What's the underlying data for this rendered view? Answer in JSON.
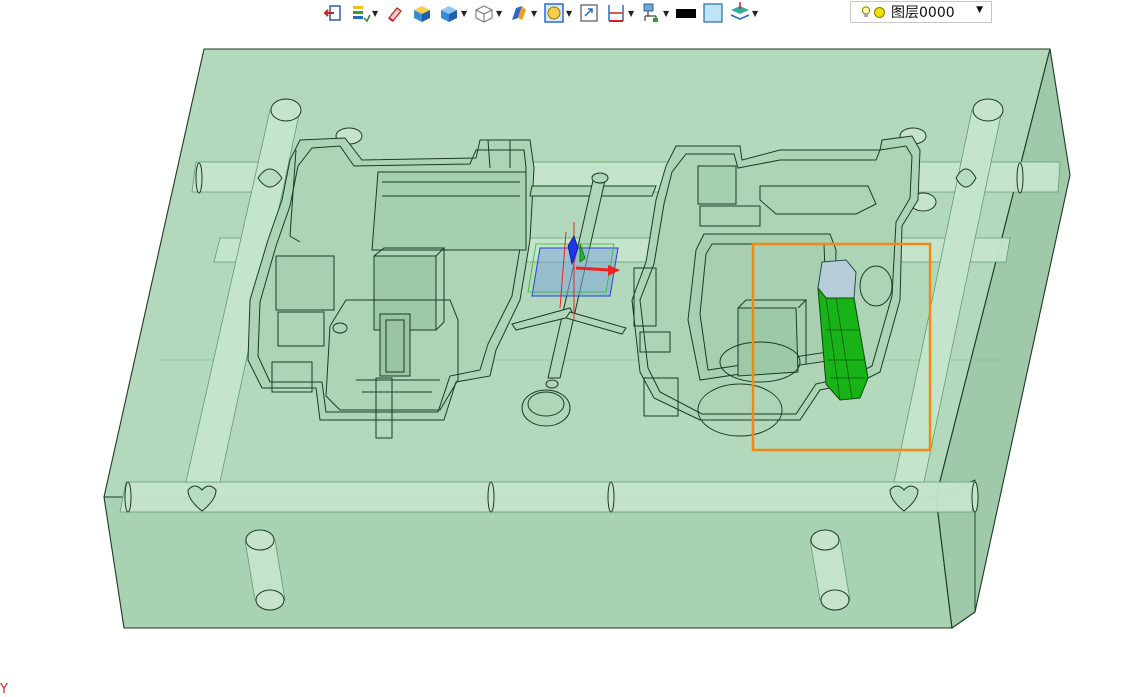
{
  "toolbar": {
    "buttons": [
      {
        "name": "exit-sketch-icon",
        "caret": false
      },
      {
        "name": "layers-list-icon",
        "caret": true
      },
      {
        "name": "eraser-icon",
        "caret": false
      },
      {
        "name": "shaded-view-icon",
        "caret": false
      },
      {
        "name": "solid-box-icon",
        "caret": true
      },
      {
        "name": "wireframe-box-icon",
        "caret": true
      },
      {
        "name": "view-orient-icon",
        "caret": true
      },
      {
        "name": "render-mode-icon",
        "caret": true
      },
      {
        "name": "zoom-fit-icon",
        "caret": false
      },
      {
        "name": "dimension-icon",
        "caret": true
      },
      {
        "name": "filter-icon",
        "caret": true
      },
      {
        "name": "color-swatch-icon",
        "caret": false
      },
      {
        "name": "transparency-icon",
        "caret": false
      },
      {
        "name": "layer-stack-icon",
        "caret": true
      }
    ],
    "layer_select": {
      "value": "图层0000"
    }
  },
  "axis": {
    "y_label": "Y"
  },
  "colors": {
    "mold_fill": "#b4d8bc",
    "mold_edge": "#1c3a24",
    "highlight_part": "#17b317",
    "selection_box": "#f08a14",
    "triad_x": "#ee2222",
    "triad_y": "#22bb22",
    "triad_z": "#2233ee"
  }
}
